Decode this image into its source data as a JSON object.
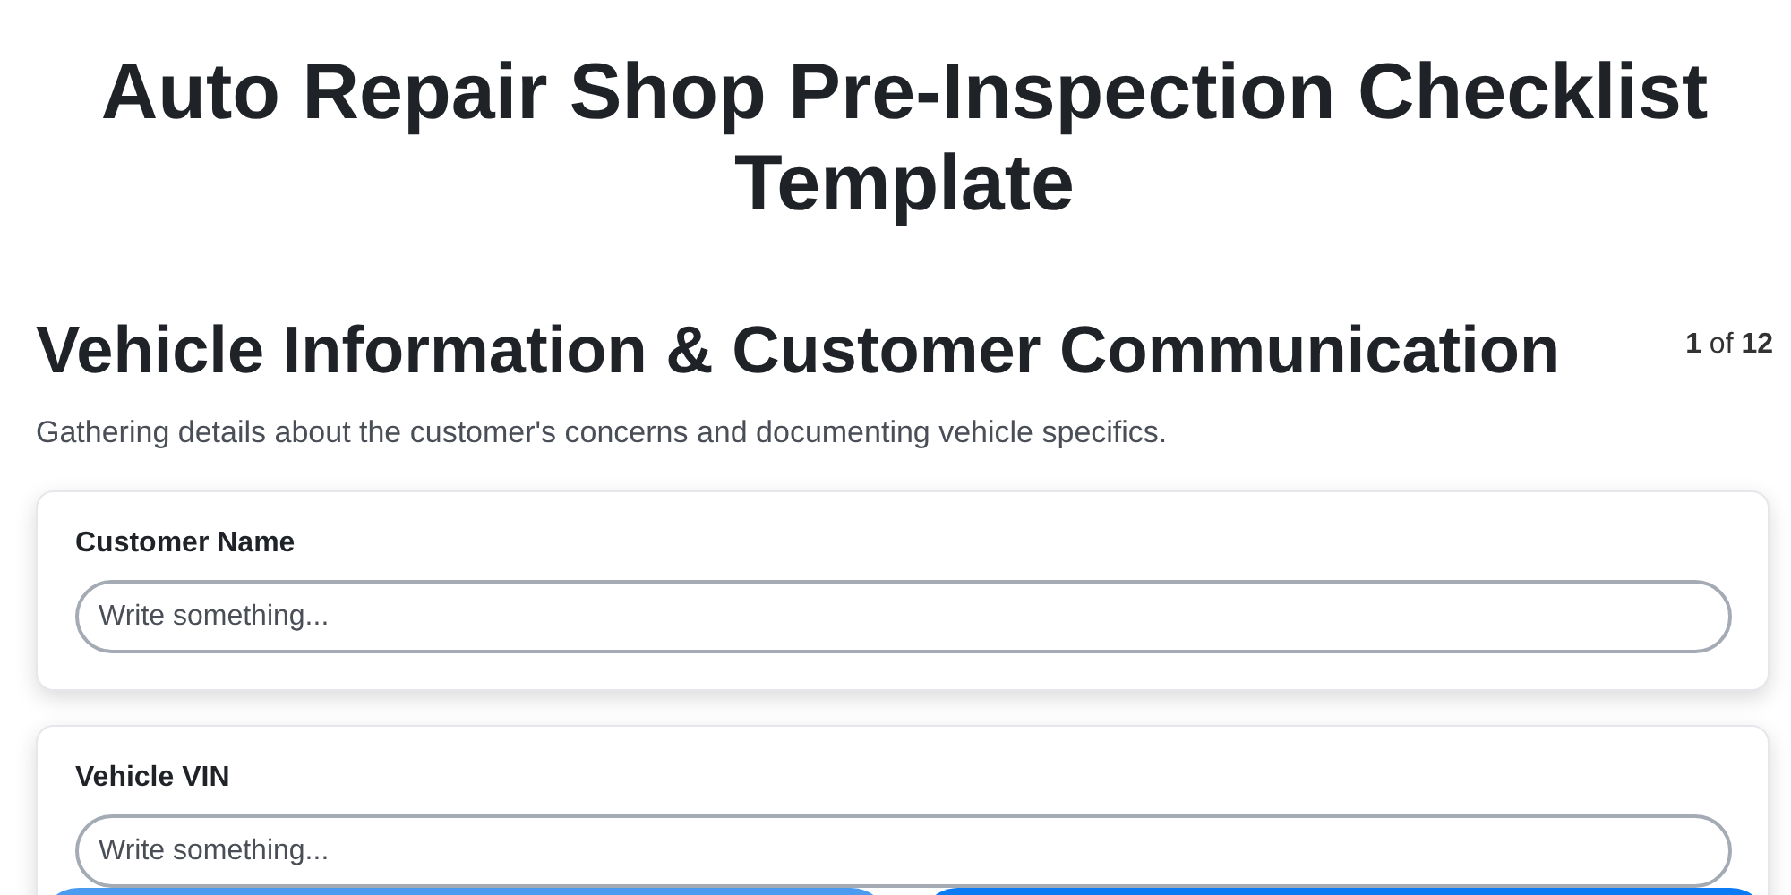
{
  "title": "Auto Repair Shop Pre-Inspection Checklist Template",
  "section": {
    "heading": "Vehicle Information & Customer Communication",
    "counter": "**1** of **12**",
    "description": "Gathering details about the customer's concerns and documenting vehicle specifics."
  },
  "fields": [
    {
      "label": "Customer Name",
      "placeholder": "Write something..."
    },
    {
      "label": "Vehicle VIN",
      "placeholder": "Write something..."
    }
  ],
  "buttons": [
    {
      "kind": "secondary"
    },
    {
      "kind": "primary"
    }
  ]
}
